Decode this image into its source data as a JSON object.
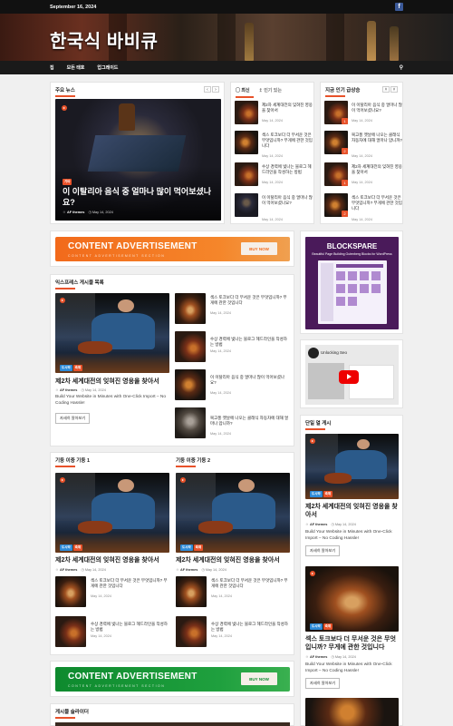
{
  "topbar": {
    "date": "September 16, 2024",
    "social_icon": "facebook-icon"
  },
  "site": {
    "title": "한국식 바비큐"
  },
  "nav": {
    "items": [
      "집",
      "모든 태호",
      "업그레이드"
    ],
    "search_icon": "search-icon"
  },
  "main_news": {
    "title": "주요 뉴스",
    "caption": "이 이탈리아 음식 중 얼마나 많이 먹어보셨나요?",
    "badge": "기타",
    "author": "AF themes",
    "date": "May 14, 2024"
  },
  "tabs": {
    "latest": "최신",
    "popular": "인기 있는"
  },
  "latest_list": [
    {
      "title": "제2차 세계대전의 잊혀진 영웅을 찾아서",
      "date": "May 14, 2024"
    },
    {
      "title": "섹스 토크보다 더 무서운 것은 무엇입니까? 무게에 관한 것입니다",
      "date": "May 14, 2024"
    },
    {
      "title": "수상 경력에 빛나는 블로그 헤드라인을 작성하는 방법",
      "date": "May 14, 2024"
    },
    {
      "title": "이 이탈리아 음식 중 얼마나 많이 먹어보셨나요?",
      "date": "May 14, 2024"
    }
  ],
  "trending": {
    "title": "지금 인기 급상승",
    "items": [
      {
        "num": "1",
        "title": "이 이탈리아 음식 중 얼마나 많이 먹어보셨나요?",
        "date": "May 14, 2024"
      },
      {
        "num": "2",
        "title": "복고풍 옛날에 나오는 클래식 자동차에 대해 얼마나 압니까?",
        "date": "May 14, 2024"
      },
      {
        "num": "1",
        "title": "제2차 세계대전의 잊혀진 영웅을 찾아서",
        "date": "May 14, 2024"
      },
      {
        "num": "2",
        "title": "섹스 토크보다 더 무서운 것은 무엇입니까? 무게에 관한 것입니다",
        "date": "May 14, 2024"
      }
    ]
  },
  "ads": [
    {
      "text": "CONTENT ADVERTISEMENT",
      "sub": "CONTENT ADVERTISEMENT SECTION",
      "button": "BUY NOW",
      "color": "#f26a1b"
    },
    {
      "text": "CONTENT ADVERTISEMENT",
      "sub": "CONTENT ADVERTISEMENT SECTION",
      "button": "BUY NOW",
      "color": "#0e8a2e"
    }
  ],
  "express": {
    "title": "익스프레스 게시물 목록",
    "badges": [
      "도시락",
      "축제"
    ],
    "main_title": "제2차 세계대전의 잊혀진 영웅을 찾아서",
    "author": "AF themes",
    "date": "May 14, 2024",
    "excerpt": "Build Your Website in Minutes with One-Click Import – No Coding Hassle!",
    "button": "자세히 알아보기",
    "list": [
      {
        "title": "섹스 토크보다 더 무서운 것은 무엇입니까? 무게에 관한 것입니다",
        "date": "May 14, 2024"
      },
      {
        "title": "수상 경력에 빛나는 블로그 헤드라인을 작성하는 방법",
        "date": "May 14, 2024"
      },
      {
        "title": "이 이탈리아 음식 중 얼마나 많이 먹어보셨나요?",
        "date": "May 14, 2024"
      },
      {
        "title": "복고풍 옛날에 나오는 클래식 자동차에 대해 얼마나 압니까?",
        "date": "May 14, 2024"
      }
    ]
  },
  "cols": [
    {
      "title": "기둥 이중 기둥 1",
      "main_title": "제2차 세계대전의 잊혀진 영웅을 찾아서",
      "author": "AF themes",
      "date": "May 14, 2024",
      "list": [
        {
          "title": "섹스 토크보다 더 무서운 것은 무엇입니까? 무게에 관한 것입니다",
          "date": "May 14, 2024"
        },
        {
          "title": "수상 경력에 빛나는 블로그 헤드라인을 작성하는 방법",
          "date": "May 14, 2024"
        }
      ]
    },
    {
      "title": "기둥 이중 기둥 2",
      "main_title": "제2차 세계대전의 잊혀진 영웅을 찾아서",
      "author": "AF themes",
      "date": "May 14, 2024",
      "list": [
        {
          "title": "섹스 토크보다 더 무서운 것은 무엇입니까? 무게에 관한 것입니다",
          "date": "May 14, 2024"
        },
        {
          "title": "수상 경력에 빛나는 블로그 헤드라인을 작성하는 방법",
          "date": "May 14, 2024"
        }
      ]
    }
  ],
  "slider": {
    "title": "게시물 슬라이더"
  },
  "sidebar": {
    "blockspare": {
      "title": "BLOCKSPARE",
      "sub": "Beautiful Page Building Gutenberg Blocks for WordPress"
    },
    "video": {
      "channel": "Unlocking Seo"
    },
    "single": {
      "title": "단일 열 게시",
      "badges": [
        "도시락",
        "축제"
      ],
      "post1": {
        "title": "제2차 세계대전의 잊혀진 영웅을 찾아서",
        "author": "AF themes",
        "date": "May 14, 2024",
        "excerpt": "Build Your Website in Minutes with One-Click Import – No Coding Hassle!",
        "button": "자세히 알아보기"
      },
      "post2": {
        "title": "섹스 토크보다 더 무서운 것은 무엇입니까? 무게에 관한 것입니다",
        "author": "AF themes",
        "date": "May 14, 2024",
        "excerpt": "Build Your Website in Minutes with One-Click Import – No Coding Hassle!",
        "button": "자세히 알아보기"
      }
    }
  }
}
